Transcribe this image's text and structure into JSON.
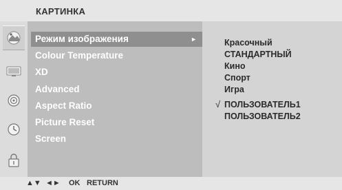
{
  "header": {
    "title": "КАРТИНКА"
  },
  "icons": [
    {
      "name": "picture-icon"
    },
    {
      "name": "screen-icon"
    },
    {
      "name": "audio-icon"
    },
    {
      "name": "clock-icon"
    },
    {
      "name": "lock-icon"
    }
  ],
  "menu": {
    "items": [
      {
        "label": "Режим изображения",
        "selected": true
      },
      {
        "label": "Colour Temperature"
      },
      {
        "label": "XD"
      },
      {
        "label": "Advanced"
      },
      {
        "label": "Aspect Ratio"
      },
      {
        "label": "Picture Reset"
      },
      {
        "label": "Screen"
      }
    ],
    "submenu_arrow": "►"
  },
  "submenu": {
    "options": [
      {
        "label": "Красочный"
      },
      {
        "label": "СТАНДАРТНЫЙ"
      },
      {
        "label": "Кино"
      },
      {
        "label": "Спорт"
      },
      {
        "label": "Игра"
      },
      {
        "label": "ПОЛЬЗОВАТЕЛЬ1",
        "checked": true
      },
      {
        "label": "ПОЛЬЗОВАТЕЛЬ2"
      }
    ],
    "check_mark": "√"
  },
  "footer": {
    "up_down": "▲▼",
    "left_right": "◄►",
    "ok": "OK",
    "return": "RETURN"
  },
  "colors": {
    "title_bar": "#e6e6e6",
    "menu_bg": "#bdbdbd",
    "menu_selected": "#8f8f8f",
    "submenu_bg": "#d4d4d4"
  }
}
